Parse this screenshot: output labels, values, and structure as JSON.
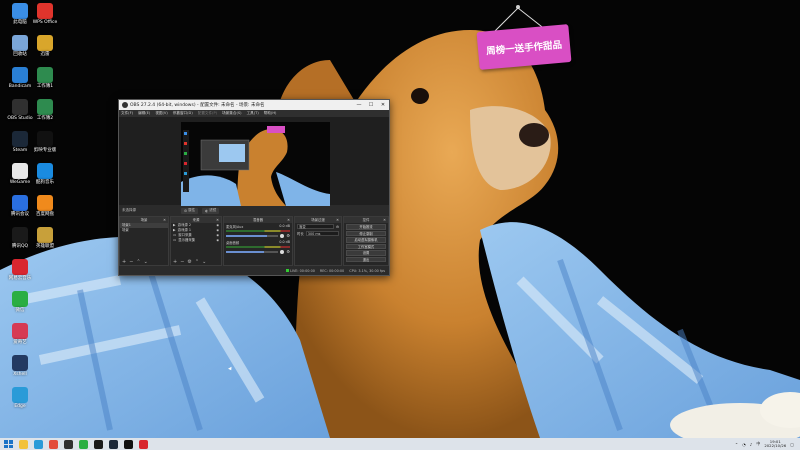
{
  "desktop": {
    "icons": [
      {
        "label": "此电脑",
        "icon": "computer-icon",
        "color": "#3a8ee6"
      },
      {
        "label": "WPS Office",
        "icon": "wps-icon",
        "color": "#e0342c"
      },
      {
        "label": "回收站",
        "icon": "recycle-bin-icon",
        "color": "#7aa6d8"
      },
      {
        "label": "迅雷",
        "icon": "thunder-icon",
        "color": "#d9a62b"
      },
      {
        "label": "Bandicam",
        "icon": "bandicam-icon",
        "color": "#2a7fd4"
      },
      {
        "label": "工作簿1",
        "icon": "excel-file-icon",
        "color": "#2e8b4f"
      },
      {
        "label": "OBS Studio",
        "icon": "obs-icon",
        "color": "#303030"
      },
      {
        "label": "工作簿2",
        "icon": "excel-file-icon",
        "color": "#2e8b4f"
      },
      {
        "label": "Steam",
        "icon": "steam-icon",
        "color": "#1b2838"
      },
      {
        "label": "剪映专业版",
        "icon": "capcut-icon",
        "color": "#111111"
      },
      {
        "label": "WeGame",
        "icon": "wegame-icon",
        "color": "#e8e8e8"
      },
      {
        "label": "酷狗音乐",
        "icon": "kugou-icon",
        "color": "#1a8be0"
      },
      {
        "label": "腾讯会议",
        "icon": "tencent-meeting-icon",
        "color": "#2a6fe0"
      },
      {
        "label": "百度网盘",
        "icon": "baidu-netdisk-icon",
        "color": "#f08a1c"
      },
      {
        "label": "腾讯QQ",
        "icon": "qq-icon",
        "color": "#1a1a1a"
      },
      {
        "label": "英雄联盟",
        "icon": "lol-icon",
        "color": "#c8a03a"
      },
      {
        "label": "网易云音乐",
        "icon": "netease-music-icon",
        "color": "#d8262f"
      },
      {
        "label": "微信",
        "icon": "wechat-icon",
        "color": "#2aae43"
      },
      {
        "label": "爱奇艺",
        "icon": "iqiyi-icon",
        "color": "#d63a54"
      },
      {
        "label": "Xshell",
        "icon": "xshell-icon",
        "color": "#233a62"
      },
      {
        "label": "Edge",
        "icon": "edge-icon",
        "color": "#2a9bd8"
      }
    ]
  },
  "sign": {
    "text": "周榜一送手作甜品",
    "color": "#d94fc4"
  },
  "obs": {
    "title": "OBS 27.2.4 (64-bit, windows) - 配置文件: 未命名 - 场景: 未命名",
    "menu": [
      "文件(F)",
      "编辑(E)",
      "视图(V)",
      "停靠窗口(D)",
      "配置文件(P)",
      "场景集合(S)",
      "工具(T)",
      "帮助(H)"
    ],
    "scene_bar": {
      "current": "未选择源",
      "props_label": "属性",
      "filters_label": "滤镜"
    },
    "docks": {
      "scenes": {
        "title": "场景",
        "items": [
          "场景1",
          "场景"
        ]
      },
      "sources": {
        "title": "来源",
        "items": [
          "游戏源 2",
          "游戏源 1",
          "窗口采集",
          "显示器采集"
        ]
      },
      "mixer": {
        "title": "混音器",
        "channels": [
          {
            "name": "麦克风/Aux",
            "db": "0.0 dB",
            "level": 0.78
          },
          {
            "name": "桌面音频",
            "db": "0.0 dB",
            "level": 0.72
          }
        ]
      },
      "transitions": {
        "title": "场景过渡",
        "type": "渐变",
        "duration_label": "时长",
        "duration": "300 ms"
      },
      "controls": {
        "title": "控件",
        "buttons": [
          "开始推流",
          "停止录制",
          "启动虚拟摄像机",
          "工作室模式",
          "设置",
          "退出"
        ]
      }
    },
    "status": {
      "live": "LIVE: 00:00:00",
      "rec": "REC: 00:00:00",
      "cpu": "CPU: 3.1%, 30.00 fps"
    }
  },
  "taskbar": {
    "apps": [
      "file-explorer-icon",
      "edge-icon",
      "chrome-icon",
      "obs-icon",
      "wechat-icon",
      "qq-icon",
      "steam-icon",
      "capcut-icon",
      "netease-music-icon"
    ],
    "time": "19:01",
    "date": "2022/10/26",
    "tray_icons": [
      "chevron-up-icon",
      "network-icon",
      "volume-icon",
      "input-method-icon"
    ]
  },
  "colors": {
    "wallpaper_bg": "#050505",
    "dog_fur": "#d38b3c",
    "blanket": "#7fb4e8",
    "obs_bg": "#2b2b2b",
    "taskbar": "#dde3ea"
  }
}
